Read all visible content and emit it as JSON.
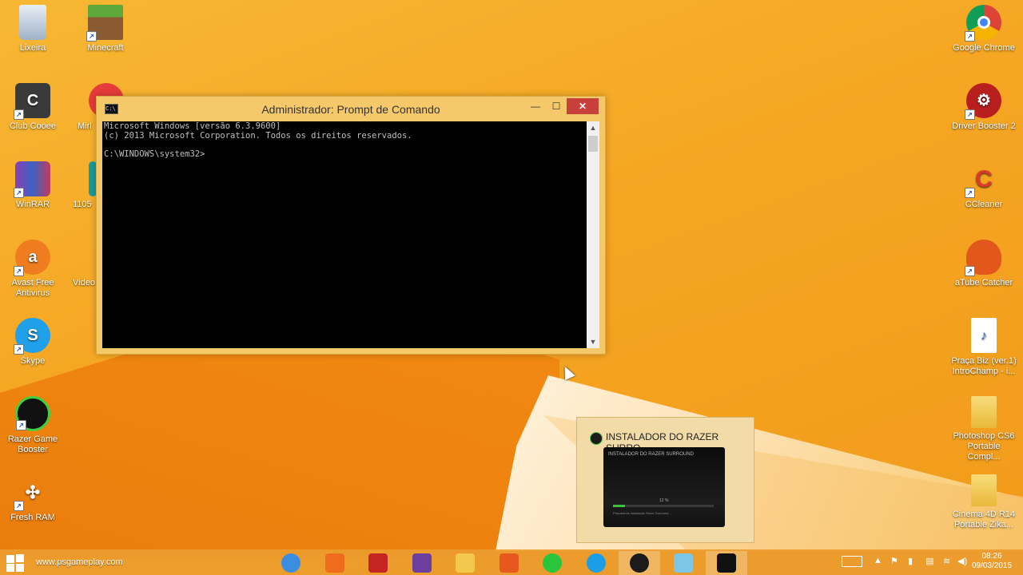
{
  "desktop": {
    "icons_left": [
      {
        "label": "Lixeira",
        "icon": "recycle-bin-icon"
      },
      {
        "label": "Club Cooee",
        "icon": "club-cooee-icon"
      },
      {
        "label": "WinRAR",
        "icon": "winrar-icon"
      },
      {
        "label": "Avast Free Antivirus",
        "icon": "avast-icon"
      },
      {
        "label": "Skype",
        "icon": "skype-icon"
      },
      {
        "label": "Razer Game Booster",
        "icon": "razer-icon"
      },
      {
        "label": "Fresh RAM",
        "icon": "fresh-ram-icon"
      }
    ],
    "icons_left2": [
      {
        "label": "Minecraft",
        "icon": "minecraft-icon"
      },
      {
        "label": "Mirl",
        "icon": "mirillis-icon"
      },
      {
        "label": "1105",
        "icon": "file-icon"
      },
      {
        "label": "Video",
        "icon": "video-icon"
      }
    ],
    "icons_right": [
      {
        "label": "Google Chrome",
        "icon": "chrome-icon"
      },
      {
        "label": "Driver Booster 2",
        "icon": "driver-booster-icon"
      },
      {
        "label": "CCleaner",
        "icon": "ccleaner-icon"
      },
      {
        "label": "aTube Catcher",
        "icon": "atube-icon"
      },
      {
        "label": "Praça Biz (ver.1) IntroChamp - i...",
        "icon": "audio-file-icon"
      },
      {
        "label": "Photoshop CS6 Portable Compl...",
        "icon": "folder-icon"
      },
      {
        "label": "Cinema 4D R14 Portable Zika...",
        "icon": "folder-icon"
      }
    ]
  },
  "cmd": {
    "title": "Administrador: Prompt de Comando",
    "line1": "Microsoft Windows [versão 6.3.9600]",
    "line2": "(c) 2013 Microsoft Corporation. Todos os direitos reservados.",
    "line3": "",
    "line4": "C:\\WINDOWS\\system32>",
    "min_label": "—",
    "max_label": "☐",
    "close_label": "✕"
  },
  "thumbnail": {
    "title": "INSTALADOR DO RAZER SURRO...",
    "preview_header": "INSTALADOR DO RAZER SURROUND",
    "preview_percent": "12 %",
    "progress": 0.12,
    "preview_message": "Preparando instalação Razer Surround..."
  },
  "taskbar": {
    "site_text": "www.psgameplay.com",
    "apps": [
      {
        "name": "chrome",
        "color": "#3b8de0"
      },
      {
        "name": "media-player",
        "color": "#ef6c1c"
      },
      {
        "name": "driver-booster",
        "color": "#c42424"
      },
      {
        "name": "winrar",
        "color": "#6b3fa0"
      },
      {
        "name": "file-explorer",
        "color": "#f2c94c"
      },
      {
        "name": "atube-catcher",
        "color": "#e8581e"
      },
      {
        "name": "razer-game-booster",
        "color": "#2bc53c"
      },
      {
        "name": "skype",
        "color": "#1b9ee6"
      },
      {
        "name": "razer-surround",
        "color": "#1b1b1b"
      },
      {
        "name": "generic-app",
        "color": "#7ec6e6"
      },
      {
        "name": "command-prompt",
        "color": "#111111"
      }
    ],
    "time": "08:26",
    "date": "09/03/2015"
  }
}
